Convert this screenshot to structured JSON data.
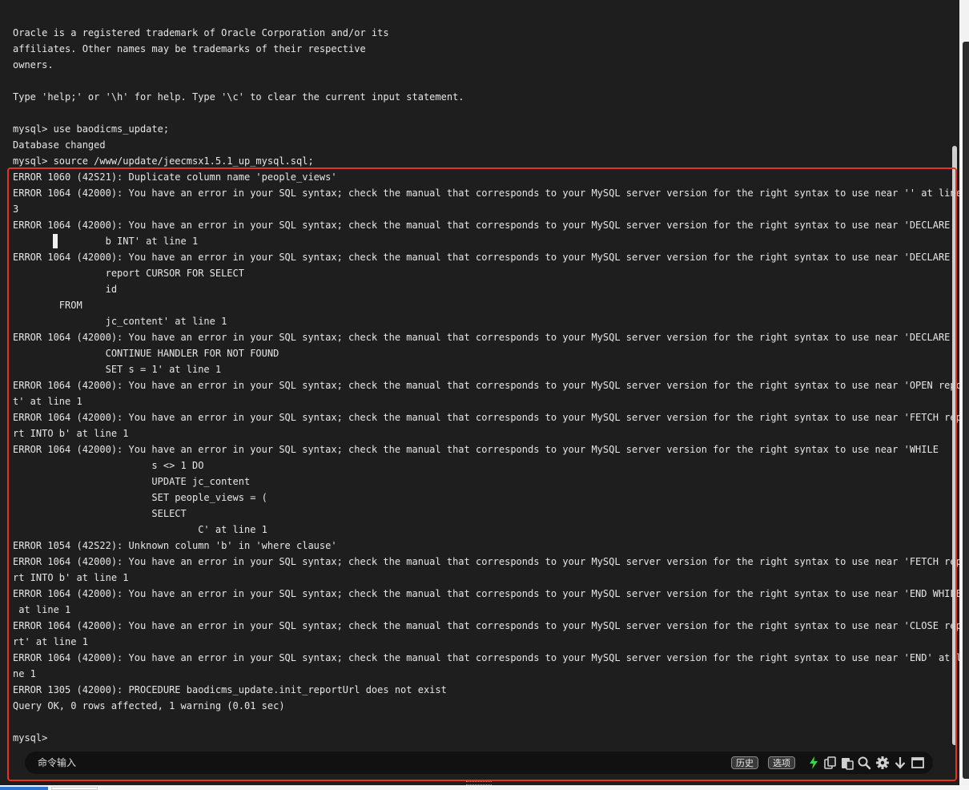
{
  "terminal": {
    "lines": [
      "Oracle is a registered trademark of Oracle Corporation and/or its",
      "affiliates. Other names may be trademarks of their respective",
      "owners.",
      "",
      "Type 'help;' or '\\h' for help. Type '\\c' to clear the current input statement.",
      "",
      "mysql> use baodicms_update;",
      "Database changed",
      "mysql> source /www/update/jeecmsx1.5.1_up_mysql.sql;",
      "ERROR 1060 (42S21): Duplicate column name 'people_views'",
      "ERROR 1064 (42000): You have an error in your SQL syntax; check the manual that corresponds to your MySQL server version for the right syntax to use near '' at line",
      "3",
      "ERROR 1064 (42000): You have an error in your SQL syntax; check the manual that corresponds to your MySQL server version for the right syntax to use near 'DECLARE",
      "                b INT' at line 1",
      "ERROR 1064 (42000): You have an error in your SQL syntax; check the manual that corresponds to your MySQL server version for the right syntax to use near 'DECLARE",
      "                report CURSOR FOR SELECT",
      "                id",
      "        FROM",
      "                jc_content' at line 1",
      "ERROR 1064 (42000): You have an error in your SQL syntax; check the manual that corresponds to your MySQL server version for the right syntax to use near 'DECLARE",
      "                CONTINUE HANDLER FOR NOT FOUND",
      "                SET s = 1' at line 1",
      "ERROR 1064 (42000): You have an error in your SQL syntax; check the manual that corresponds to your MySQL server version for the right syntax to use near 'OPEN repor",
      "t' at line 1",
      "ERROR 1064 (42000): You have an error in your SQL syntax; check the manual that corresponds to your MySQL server version for the right syntax to use near 'FETCH repo",
      "rt INTO b' at line 1",
      "ERROR 1064 (42000): You have an error in your SQL syntax; check the manual that corresponds to your MySQL server version for the right syntax to use near 'WHILE",
      "                        s <> 1 DO",
      "                        UPDATE jc_content",
      "                        SET people_views = (",
      "                        SELECT",
      "                                C' at line 1",
      "ERROR 1054 (42S22): Unknown column 'b' in 'where clause'",
      "ERROR 1064 (42000): You have an error in your SQL syntax; check the manual that corresponds to your MySQL server version for the right syntax to use near 'FETCH repo",
      "rt INTO b' at line 1",
      "ERROR 1064 (42000): You have an error in your SQL syntax; check the manual that corresponds to your MySQL server version for the right syntax to use near 'END WHILE'",
      " at line 1",
      "ERROR 1064 (42000): You have an error in your SQL syntax; check the manual that corresponds to your MySQL server version for the right syntax to use near 'CLOSE repo",
      "rt' at line 1",
      "ERROR 1064 (42000): You have an error in your SQL syntax; check the manual that corresponds to your MySQL server version for the right syntax to use near 'END' at li",
      "ne 1",
      "ERROR 1305 (42000): PROCEDURE baodicms_update.init_reportUrl does not exist",
      "Query OK, 0 rows affected, 1 warning (0.01 sec)",
      "",
      "mysql>"
    ]
  },
  "command_bar": {
    "placeholder": "命令输入",
    "history_label": "历史",
    "options_label": "选项"
  },
  "icons": {
    "lightning": "lightning-icon",
    "copy": "copy-icon",
    "paste": "paste-icon",
    "search": "search-icon",
    "settings": "gear-icon",
    "download": "arrow-down-icon",
    "window": "window-icon"
  },
  "colors": {
    "terminal_bg": "#1e1e1e",
    "text": "#e6e6e6",
    "highlight_border": "#e8321f",
    "lightning": "#3fd23f"
  }
}
